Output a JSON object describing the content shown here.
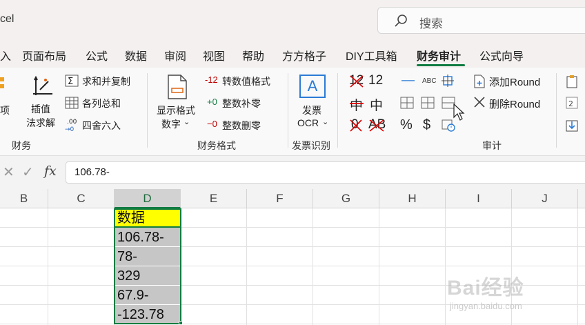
{
  "title_bar": {
    "app_title": "cel",
    "search_placeholder": "搜索"
  },
  "tabs": [
    {
      "label": "入"
    },
    {
      "label": "页面布局"
    },
    {
      "label": "公式"
    },
    {
      "label": "数据"
    },
    {
      "label": "审阅"
    },
    {
      "label": "视图"
    },
    {
      "label": "帮助"
    },
    {
      "label": "方方格子"
    },
    {
      "label": "DIY工具箱"
    },
    {
      "label": "财务审计",
      "active": true
    },
    {
      "label": "公式向导"
    }
  ],
  "ribbon": {
    "group_finance": {
      "label": "财务",
      "partial_left": "项",
      "interp_line1": "插值",
      "interp_line2": "法求解",
      "sum_copy": "求和并复制",
      "col_total": "各列总和",
      "round_half": "四舍六入"
    },
    "group_format": {
      "label": "财务格式",
      "show_line1": "显示格式",
      "show_line2": "数字",
      "convert_prefix": "-12",
      "convert_label": "转数值格式",
      "pad_prefix": "+0",
      "pad_label": "整数补零",
      "del_prefix": "−0",
      "del_label": "整数删零"
    },
    "group_ocr": {
      "label": "发票识别",
      "line1": "发票",
      "line2": "OCR",
      "icon_letter": "A"
    },
    "group_audit": {
      "label": "审计",
      "g_12a": "12",
      "g_12b": "12",
      "g_zhong_a": "中",
      "g_zhong_b": "中",
      "g_zero": "0",
      "g_ab": "AB",
      "g_percent": "%",
      "g_dollar": "$",
      "g_abc": "ABC",
      "add_round": "添加Round",
      "del_round": "删除Round"
    }
  },
  "formula_bar": {
    "value": "106.78-"
  },
  "columns": [
    "B",
    "C",
    "D",
    "E",
    "F",
    "G",
    "H",
    "I",
    "J"
  ],
  "selected_column": "D",
  "cells": [
    "数据",
    "106.78-",
    "78-",
    "329",
    "67.9-",
    "-123.78"
  ],
  "watermark": {
    "logo": "Bai经验",
    "url": "jingyan.baidu.com"
  },
  "colors": {
    "accent": "#107c41",
    "header_fill": "#ffff00",
    "selection_fill": "#c6c6c6"
  }
}
